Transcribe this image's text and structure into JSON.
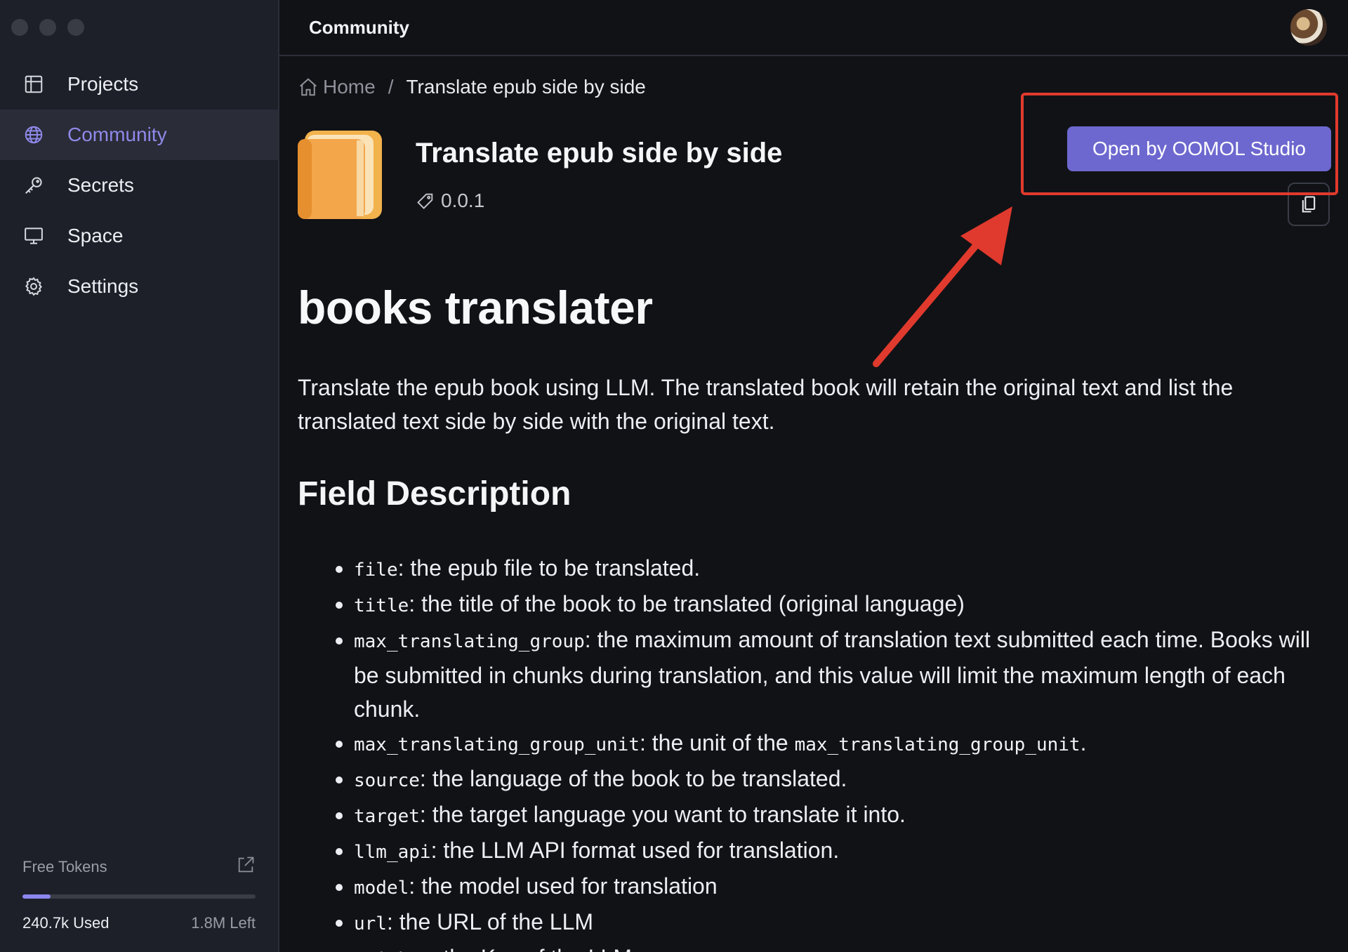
{
  "window": {
    "title": "Community"
  },
  "sidebar": {
    "items": [
      {
        "label": "Projects",
        "icon": "grid-icon",
        "active": false
      },
      {
        "label": "Community",
        "icon": "globe-icon",
        "active": true
      },
      {
        "label": "Secrets",
        "icon": "key-icon",
        "active": false
      },
      {
        "label": "Space",
        "icon": "monitor-icon",
        "active": false
      },
      {
        "label": "Settings",
        "icon": "gear-icon",
        "active": false
      }
    ],
    "tokens": {
      "title": "Free Tokens",
      "used": "240.7k Used",
      "left": "1.8M Left",
      "used_fraction": 0.12
    }
  },
  "breadcrumb": {
    "home": "Home",
    "separator": "/",
    "current": "Translate epub side by side"
  },
  "package": {
    "title": "Translate epub side by side",
    "version": "0.0.1",
    "open_button": "Open by OOMOL Studio"
  },
  "readme": {
    "title": "books translater",
    "description": "Translate the epub book using LLM. The translated book will retain the original text and list the translated text side by side with the original text.",
    "field_heading": "Field Description",
    "fields": [
      {
        "code": "file",
        "text": ": the epub file to be translated."
      },
      {
        "code": "title",
        "text": ": the title of the book to be translated (original language)"
      },
      {
        "code": "max_translating_group",
        "text": ": the maximum amount of translation text submitted each time. Books will be submitted in chunks during translation, and this value will limit the maximum length of each chunk."
      },
      {
        "code": "max_translating_group_unit",
        "text": ": the unit of the ",
        "code2": "max_translating_group_unit",
        "text2": "."
      },
      {
        "code": "source",
        "text": ": the language of the book to be translated."
      },
      {
        "code": "target",
        "text": ": the target language you want to translate it into."
      },
      {
        "code": "llm_api",
        "text": ": the LLM API format used for translation."
      },
      {
        "code": "model",
        "text": ": the model used for translation"
      },
      {
        "code": "url",
        "text": ": the URL of the LLM"
      },
      {
        "code": "api_key",
        "text": ": the Key of the LLM"
      }
    ]
  },
  "colors": {
    "accent": "#6d68cf",
    "active_nav": "#8f89ea",
    "annotation": "#e03a2e",
    "background": "#111216",
    "sidebar": "#1d1f29"
  }
}
